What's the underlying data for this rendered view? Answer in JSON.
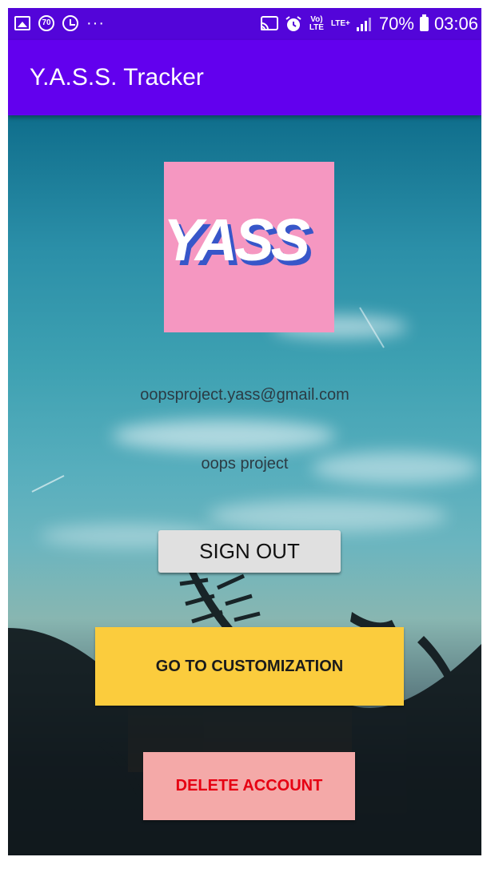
{
  "status_bar": {
    "left_icons": [
      "gallery-icon",
      "badge-70-icon",
      "history-icon",
      "more-dots-icon"
    ],
    "badge_text": "70",
    "dots": "···",
    "cast_icon": "cast-icon",
    "alarm_icon": "alarm-icon",
    "volte_text": "Vo) LTE",
    "lte_text": "LTE+",
    "battery_percent": "70%",
    "battery_icon": "battery-icon",
    "time": "03:06"
  },
  "app_bar": {
    "title": "Y.A.S.S. Tracker"
  },
  "profile": {
    "logo_text": "YASS",
    "email": "oopsproject.yass@gmail.com",
    "name": "oops project"
  },
  "buttons": {
    "sign_out": "SIGN OUT",
    "customize": "GO TO CUSTOMIZATION",
    "delete": "DELETE ACCOUNT"
  },
  "colors": {
    "status_bar": "#5305d9",
    "app_bar": "#6200ee",
    "logo_bg": "#f597c1",
    "customize_btn": "#fbcc3d",
    "delete_btn": "#f4a9a8",
    "delete_text": "#e60012"
  }
}
